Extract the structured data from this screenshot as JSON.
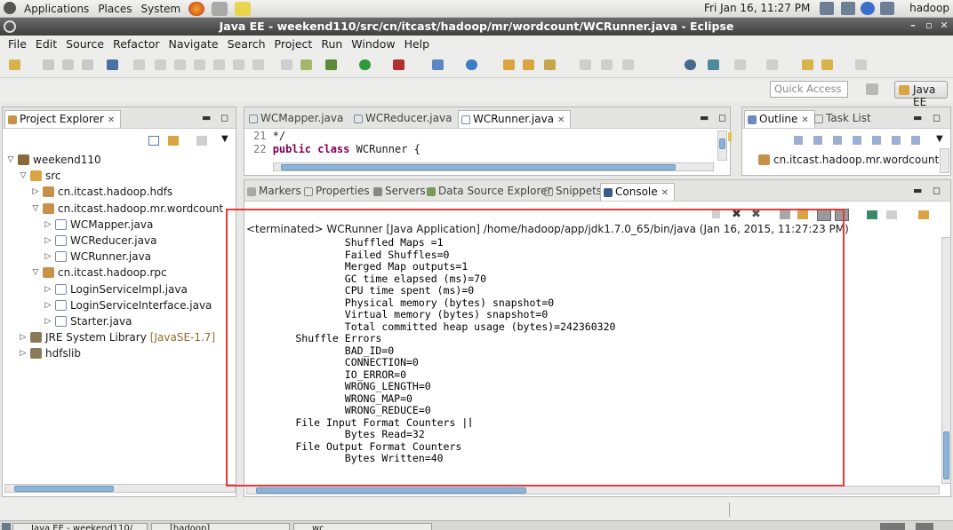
{
  "gnome_panel": {
    "menus": [
      "Applications",
      "Places",
      "System"
    ],
    "clock": "Fri Jan 16, 11:27 PM",
    "user": "hadoop"
  },
  "window": {
    "title": "Java EE - weekend110/src/cn/itcast/hadoop/mr/wordcount/WCRunner.java - Eclipse"
  },
  "menubar": [
    "File",
    "Edit",
    "Source",
    "Refactor",
    "Navigate",
    "Search",
    "Project",
    "Run",
    "Window",
    "Help"
  ],
  "toolbar": {
    "quick_access_placeholder": "Quick Access",
    "perspective": "Java EE"
  },
  "project_explorer": {
    "title": "Project Explorer",
    "tree": [
      {
        "label": "weekend110",
        "depth": 0,
        "expanded": true,
        "icon": "project-icon"
      },
      {
        "label": "src",
        "depth": 1,
        "expanded": true,
        "icon": "source-folder-icon"
      },
      {
        "label": "cn.itcast.hadoop.hdfs",
        "depth": 2,
        "expanded": false,
        "icon": "package-icon"
      },
      {
        "label": "cn.itcast.hadoop.mr.wordcount",
        "depth": 2,
        "expanded": true,
        "icon": "package-icon"
      },
      {
        "label": "WCMapper.java",
        "depth": 3,
        "expanded": false,
        "icon": "java-file-icon"
      },
      {
        "label": "WCReducer.java",
        "depth": 3,
        "expanded": false,
        "icon": "java-file-icon"
      },
      {
        "label": "WCRunner.java",
        "depth": 3,
        "expanded": false,
        "icon": "java-file-icon"
      },
      {
        "label": "cn.itcast.hadoop.rpc",
        "depth": 2,
        "expanded": true,
        "icon": "package-icon"
      },
      {
        "label": "LoginServiceImpl.java",
        "depth": 3,
        "expanded": false,
        "icon": "java-file-icon"
      },
      {
        "label": "LoginServiceInterface.java",
        "depth": 3,
        "expanded": false,
        "icon": "java-file-icon"
      },
      {
        "label": "Starter.java",
        "depth": 3,
        "expanded": false,
        "icon": "java-file-icon"
      },
      {
        "label": "JRE System Library",
        "decoration": "[JavaSE-1.7]",
        "depth": 1,
        "expanded": false,
        "icon": "library-icon"
      },
      {
        "label": "hdfslib",
        "depth": 1,
        "expanded": false,
        "icon": "library-icon"
      }
    ]
  },
  "editor": {
    "tabs": [
      "WCMapper.java",
      "WCReducer.java",
      "WCRunner.java"
    ],
    "active_tab": "WCRunner.java",
    "lines": [
      {
        "no": "21",
        "text": " */"
      },
      {
        "no": "22",
        "keywords": "public class",
        "text": " WCRunner {"
      }
    ]
  },
  "outline": {
    "tabs": [
      "Outline",
      "Task List"
    ],
    "items": [
      "cn.itcast.hadoop.mr.wordcount"
    ]
  },
  "bottom_panel": {
    "tabs": [
      "Markers",
      "Properties",
      "Servers",
      "Data Source Explorer",
      "Snippets",
      "Console"
    ],
    "active_tab": "Console",
    "console_header": "<terminated> WCRunner [Java Application] /home/hadoop/app/jdk1.7.0_65/bin/java (Jan 16, 2015, 11:27:23 PM)",
    "console_lines": [
      "                Shuffled Maps =1",
      "                Failed Shuffles=0",
      "                Merged Map outputs=1",
      "                GC time elapsed (ms)=70",
      "                CPU time spent (ms)=0",
      "                Physical memory (bytes) snapshot=0",
      "                Virtual memory (bytes) snapshot=0",
      "                Total committed heap usage (bytes)=242360320",
      "        Shuffle Errors",
      "                BAD_ID=0",
      "                CONNECTION=0",
      "                IO_ERROR=0",
      "                WRONG_LENGTH=0",
      "                WRONG_MAP=0",
      "                WRONG_REDUCE=0",
      "        File Input Format Counters |",
      "                Bytes Read=32",
      "        File Output Format Counters",
      "                Bytes Written=40"
    ]
  },
  "taskbar": [
    "Java EE - weekend110/",
    "[hadoop]",
    "wc"
  ],
  "colors": {
    "highlight": "#e53a3a",
    "keyword": "#7f0055",
    "scroll_thumb": "#8db3d8"
  }
}
